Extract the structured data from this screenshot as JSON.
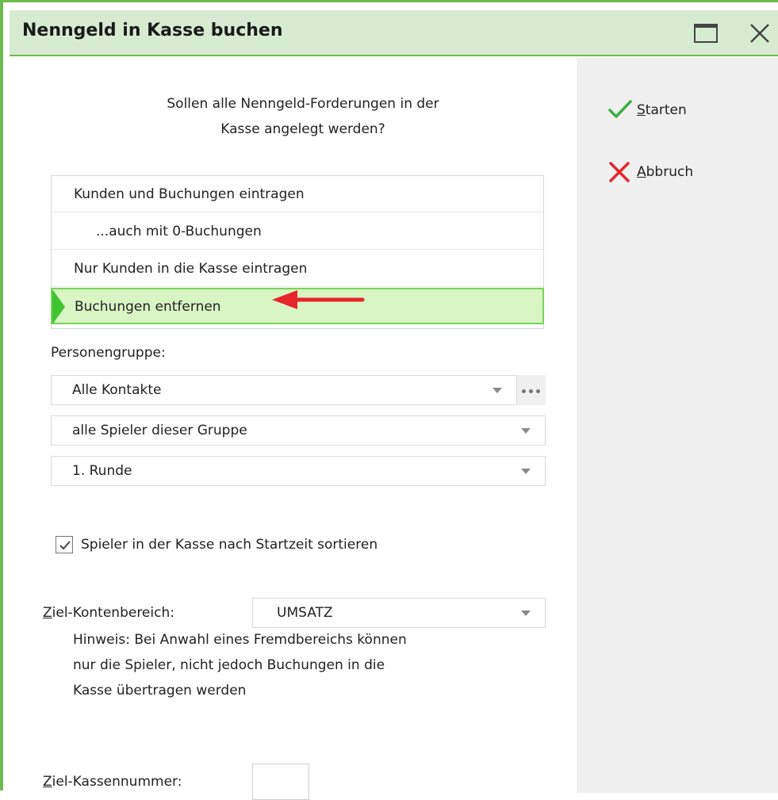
{
  "window": {
    "title": "Nenngeld in Kasse buchen"
  },
  "question": {
    "line1": "Sollen alle Nenngeld-Forderungen in der",
    "line2": "Kasse angelegt werden?"
  },
  "options": [
    {
      "label": "Kunden und Buchungen eintragen",
      "selected": false
    },
    {
      "label": "...auch mit 0-Buchungen",
      "selected": false
    },
    {
      "label": "Nur Kunden in die Kasse eintragen",
      "selected": false
    },
    {
      "label": "Buchungen entfernen",
      "selected": true
    }
  ],
  "personengruppe": {
    "label": "Personengruppe:",
    "group_value": "Alle Kontakte",
    "players_value": "alle Spieler dieser Gruppe",
    "round_value": "1. Runde"
  },
  "sort": {
    "checked": true,
    "label": "Spieler in der Kasse nach Startzeit sortieren"
  },
  "ziel_konten": {
    "label_first": "Z",
    "label_rest": "iel-Kontenbereich:",
    "value": "UMSATZ"
  },
  "hint": {
    "line1": "Hinweis: Bei Anwahl eines Fremdbereichs können",
    "line2": "nur die Spieler, nicht jedoch Buchungen in die",
    "line3": "Kasse übertragen werden"
  },
  "ziel_kasse": {
    "label_first": "Z",
    "label_rest": "iel-Kassennummer:",
    "value": ""
  },
  "actions": {
    "start_first": "S",
    "start_rest": "tarten",
    "cancel_first": "A",
    "cancel_rest": "bbruch"
  },
  "colors": {
    "accent_green": "#6cbb4c",
    "title_bg": "#d7ebd3",
    "selected_bg": "#d8f5c4",
    "annotation_arrow": "#e8252a",
    "start_check": "#3fae49",
    "cancel_x": "#e2262b"
  }
}
